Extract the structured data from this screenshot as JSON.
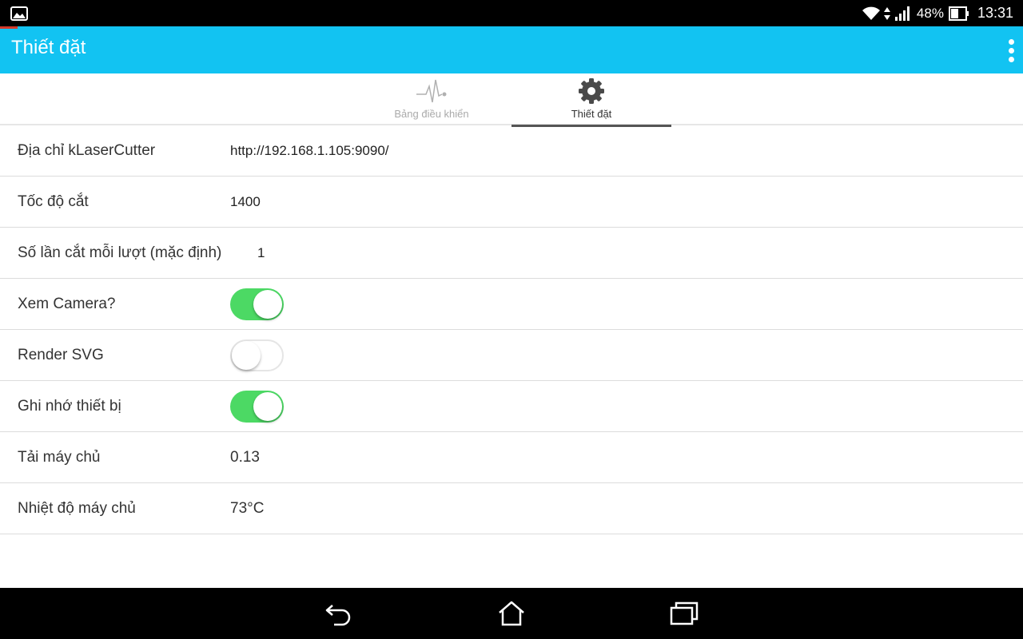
{
  "status_bar": {
    "battery_percent": "48%",
    "time": "13:31",
    "left_icon": "image-icon",
    "icons": [
      "wifi-icon",
      "data-arrows-icon",
      "signal-icon",
      "battery-icon"
    ]
  },
  "app_bar": {
    "title": "Thiết đặt",
    "accent_color": "#12c3f2"
  },
  "tabs": [
    {
      "label": "Bảng điều khiển",
      "icon": "pulse-icon",
      "active": false
    },
    {
      "label": "Thiết đặt",
      "icon": "gear-icon",
      "active": true
    }
  ],
  "settings": {
    "address": {
      "label": "Địa chỉ kLaserCutter",
      "value": "http://192.168.1.105:9090/"
    },
    "cut_speed": {
      "label": "Tốc độ cắt",
      "value": "1400"
    },
    "passes": {
      "label": "Số lần cắt mỗi lượt (mặc định)",
      "value": "1"
    },
    "camera": {
      "label": "Xem Camera?",
      "on": true
    },
    "render_svg": {
      "label": "Render SVG",
      "on": false
    },
    "remember_device": {
      "label": "Ghi nhớ thiết bị",
      "on": true
    },
    "server_load": {
      "label": "Tải máy chủ",
      "value": "0.13"
    },
    "server_temp": {
      "label": "Nhiệt độ máy chủ",
      "value": "73°C"
    }
  },
  "toggle_on_color": "#4cd964",
  "nav_bar": {
    "buttons": [
      "back-icon",
      "home-icon",
      "recent-apps-icon"
    ]
  }
}
